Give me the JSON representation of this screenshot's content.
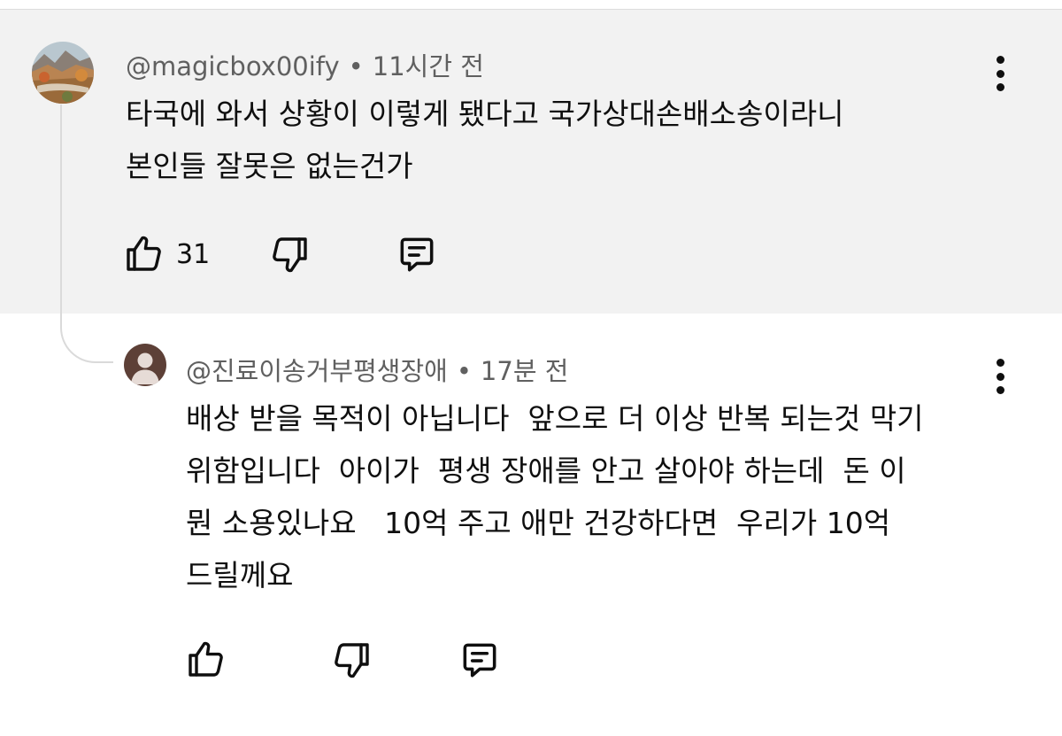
{
  "colors": {
    "parent_background": "#f2f2f2",
    "reply_background": "#ffffff",
    "meta_text": "#606060",
    "body_text": "#0f0f0f",
    "thread_line": "#dadada"
  },
  "comments": [
    {
      "author": "@magicbox00ify",
      "separator": "•",
      "time": "11시간 전",
      "lines": [
        "타국에 와서 상황이 이렇게 됐다고 국가상대손배소송이라니",
        "본인들 잘못은 없는건가"
      ],
      "likes": "31",
      "avatar_icon": "landscape-photo-avatar",
      "actions": [
        "like-icon",
        "dislike-icon",
        "reply-icon"
      ],
      "menu_icon": "more-vert-icon"
    },
    {
      "author": "@진료이송거부평생장애",
      "separator": "•",
      "time": "17분 전",
      "lines": [
        "배상 받을 목적이 아닙니다  앞으로 더 이상 반복 되는것 막기",
        "위함입니다  아이가  평생 장애를 안고 살아야 하는데  돈 이",
        "뭔 소용있나요   10억 주고 애만 건강하다면  우리가 10억",
        "드릴께요"
      ],
      "avatar_icon": "default-person-avatar",
      "actions": [
        "like-icon",
        "dislike-icon",
        "reply-icon"
      ],
      "menu_icon": "more-vert-icon"
    }
  ]
}
